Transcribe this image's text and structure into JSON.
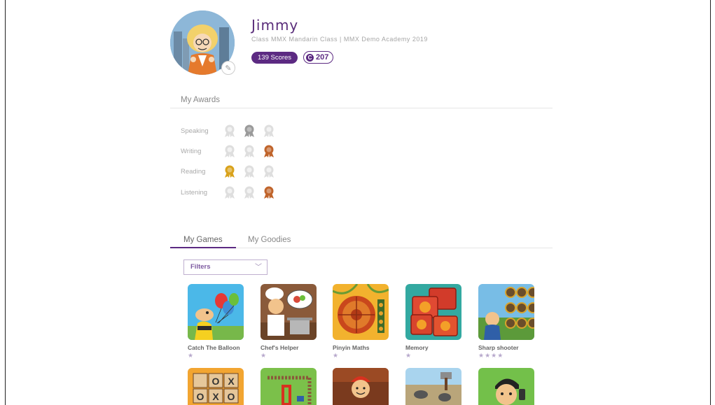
{
  "profile": {
    "name": "Jimmy",
    "class_info": "Class MMX Mandarin Class   |   MMX Demo Academy 2019",
    "scores": "139 Scores",
    "coins": "207",
    "coin_symbol": "C"
  },
  "awards": {
    "title": "My Awards",
    "rows": [
      {
        "label": "Speaking",
        "medals": [
          "none",
          "silver",
          "none"
        ]
      },
      {
        "label": "Writing",
        "medals": [
          "none",
          "none",
          "bronze"
        ]
      },
      {
        "label": "Reading",
        "medals": [
          "gold",
          "none",
          "none"
        ]
      },
      {
        "label": "Listening",
        "medals": [
          "none",
          "none",
          "bronze"
        ]
      }
    ]
  },
  "tabs": {
    "games": "My Games",
    "goodies": "My Goodies"
  },
  "filters": {
    "label": "Filters",
    "chevron": "﹀"
  },
  "games": [
    {
      "title": "Catch The Balloon",
      "stars": "★"
    },
    {
      "title": "Chef's Helper",
      "stars": "★"
    },
    {
      "title": "Pinyin Maths",
      "stars": "★"
    },
    {
      "title": "Memory",
      "stars": "★"
    },
    {
      "title": "Sharp shooter",
      "stars": "★★★★"
    }
  ],
  "colors": {
    "primary": "#5c2a82",
    "gold": "#d9a21b",
    "silver": "#9a9a9a",
    "bronze": "#c0642b",
    "empty": "#dedede"
  },
  "icons": {
    "edit": "pencil-icon",
    "coin": "coin-icon",
    "medal": "award-ribbon-icon"
  }
}
